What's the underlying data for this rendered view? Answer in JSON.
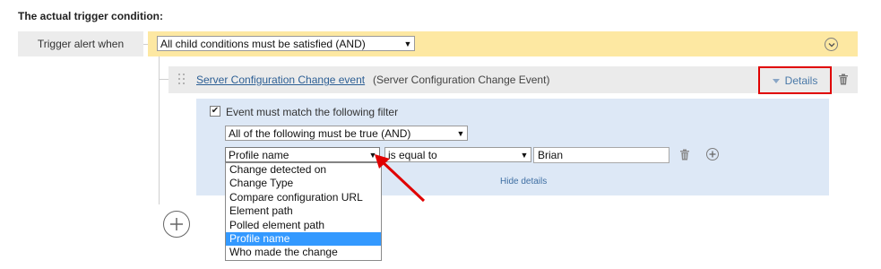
{
  "heading": "The actual trigger condition:",
  "trigger": {
    "label": "Trigger alert when",
    "condition_select": "All child conditions must be satisfied (AND)"
  },
  "event": {
    "name": "Server Configuration Change event",
    "type": "(Server Configuration Change Event)",
    "details_label": "Details"
  },
  "filter": {
    "checkbox_checked": true,
    "checkbox_label": "Event must match the following filter",
    "logic_select": "All of the following must be true (AND)",
    "field_select": "Profile name",
    "operator_select": "is equal to",
    "value": "Brian",
    "hide_details": "Hide details",
    "field_options": [
      "Change detected on",
      "Change Type",
      "Compare configuration URL",
      "Element path",
      "Polled element path",
      "Profile name",
      "Who made the change"
    ],
    "selected_option": "Profile name"
  },
  "colors": {
    "accent_red": "#e00000",
    "highlight_blue": "#3399ff",
    "link_blue": "#2d5f95",
    "yellow_bar": "#fde8a2",
    "panel_blue": "#dde8f6"
  },
  "icons": [
    "chevron-down-circle-icon",
    "drag-handle-icon",
    "trash-icon",
    "plus-circle-icon",
    "red-arrow-annotation"
  ]
}
